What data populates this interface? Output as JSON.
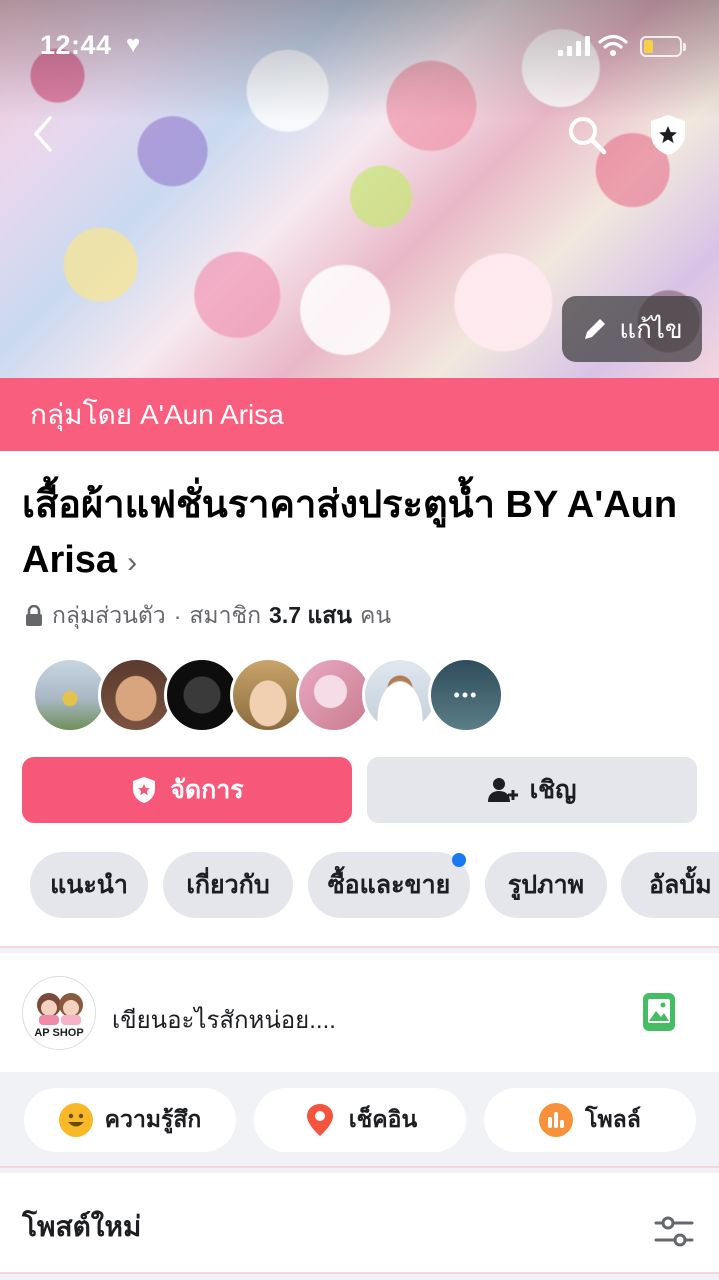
{
  "status_bar": {
    "time": "12:44",
    "heart": "♥"
  },
  "cover": {
    "edit_label": "แก้ไข"
  },
  "group": {
    "by_label": "กลุ่มโดย A'Aun Arisa",
    "title": "เสื้อผ้าแฟชั่นราคาส่งประตูน้ำ BY A'Aun Arisa",
    "title_chevron": "›",
    "privacy": "กลุ่มส่วนตัว",
    "separator": "·",
    "members_prefix": "สมาชิก",
    "members_count": "3.7 แสน",
    "members_suffix": "คน",
    "more_members": "•••"
  },
  "buttons": {
    "manage": "จัดการ",
    "invite": "เชิญ"
  },
  "tabs": [
    {
      "label": "แนะนำ"
    },
    {
      "label": "เกี่ยวกับ"
    },
    {
      "label": "ซื้อและขาย"
    },
    {
      "label": "รูปภาพ"
    },
    {
      "label": "อัลบั้ม"
    }
  ],
  "composer": {
    "placeholder": "เขียนอะไรสักหน่อย....",
    "avatar_text": "AP SHOP"
  },
  "actions": [
    {
      "label": "ความรู้สึก",
      "icon": "smile-icon",
      "color": "#f7b928"
    },
    {
      "label": "เช็คอิน",
      "icon": "location-pin-icon",
      "color": "#f5533d"
    },
    {
      "label": "โพลล์",
      "icon": "poll-icon",
      "color": "#f7923b"
    }
  ],
  "feed": {
    "new_posts": "โพสต์ใหม่"
  },
  "colors": {
    "brand_pink": "#fa5e7e",
    "manage_pink": "#f7587a",
    "notification_blue": "#1877f2"
  }
}
